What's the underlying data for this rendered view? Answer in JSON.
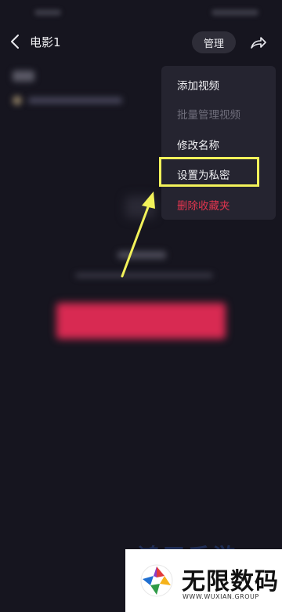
{
  "header": {
    "title": "电影1",
    "manage_label": "管理"
  },
  "menu": {
    "items": [
      {
        "label": "添加视频",
        "state": "enabled"
      },
      {
        "label": "批量管理视频",
        "state": "disabled"
      },
      {
        "label": "修改名称",
        "state": "enabled"
      },
      {
        "label": "设置为私密",
        "state": "highlighted"
      },
      {
        "label": "删除收藏夹",
        "state": "destructive"
      }
    ]
  },
  "annotation": {
    "highlight_color": "#f2f25a"
  },
  "watermark": {
    "name": "无限数码",
    "sub": "WWW.WUXIAN.GROUP",
    "back_text": "鸿天手游"
  },
  "colors": {
    "background": "#16151f",
    "menu_background": "#252430",
    "danger": "#e2354f",
    "primary_button": "#d82a52"
  }
}
